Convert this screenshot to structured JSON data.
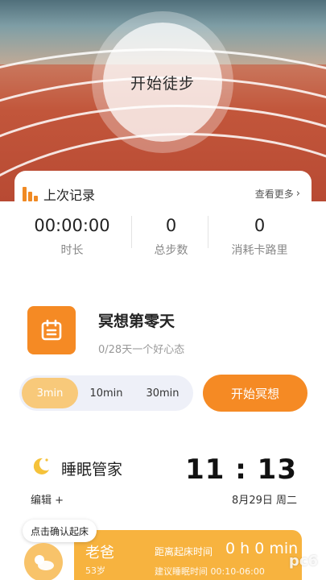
{
  "hero": {
    "start_walk_label": "开始徒步"
  },
  "record": {
    "title": "上次记录",
    "more_label": "查看更多",
    "stats": [
      {
        "value": "00:00:00",
        "label": "时长"
      },
      {
        "value": "0",
        "label": "总步数"
      },
      {
        "value": "0",
        "label": "消耗卡路里"
      }
    ]
  },
  "meditation": {
    "icon": "calendar-icon",
    "title": "冥想第零天",
    "subtitle": "0/28天一个好心态",
    "durations": [
      "3min",
      "10min",
      "30min"
    ],
    "selected_duration": "3min",
    "start_label": "开始冥想",
    "accent_color": "#f58a24"
  },
  "sleep": {
    "icon": "moon-icon",
    "title": "睡眠管家",
    "edit_label": "编辑 +",
    "time": "11 : 13",
    "date": "8月29日 周二",
    "tooltip": "点击确认起床",
    "profile": {
      "name": "老爸",
      "age": "53岁",
      "wake_label": "距离起床时间",
      "wake_value": "0 h 0 min",
      "recommend": "建议睡眠时间 00:10-06:00"
    },
    "card_color": "#f7b33f"
  },
  "watermark": "pc6"
}
